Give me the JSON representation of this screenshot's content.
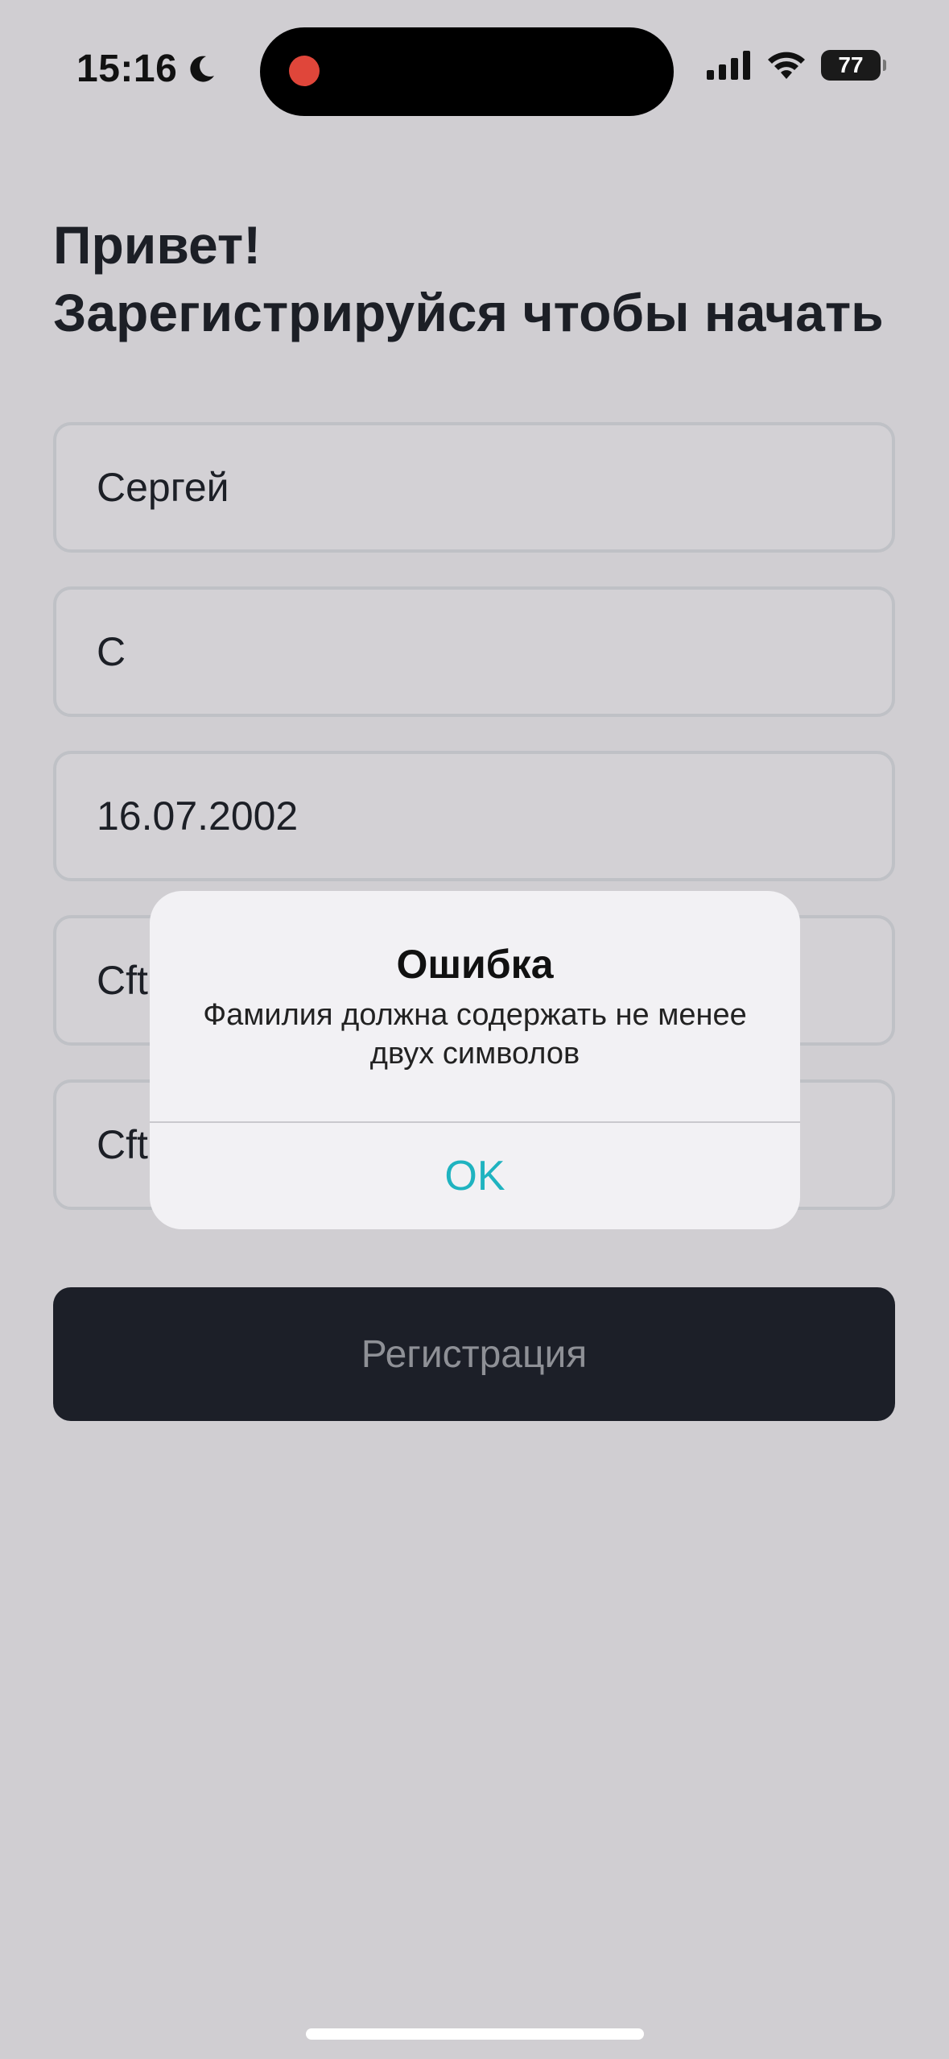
{
  "status_bar": {
    "time": "15:16",
    "battery": "77",
    "icons": [
      "moon-icon",
      "cellular-signal-icon",
      "wifi-icon",
      "battery-icon"
    ]
  },
  "recording_indicator": {
    "color": "#e0463a"
  },
  "heading": {
    "line1": "Привет!",
    "line2": "Зарегистрируйся чтобы начать"
  },
  "form": {
    "first_name": "Сергей",
    "last_name": "С",
    "birth_date": "16.07.2002",
    "field4": "Cft",
    "field5": "Cft"
  },
  "register_button": {
    "label": "Регистрация"
  },
  "alert": {
    "title": "Ошибка",
    "message": "Фамилия должна содержать не менее двух символов",
    "ok_label": "OK",
    "ok_color": "#1fb3c0"
  },
  "colors": {
    "background": "#d0ced2",
    "button": "#1c1f28",
    "field_border": "#bfc1c6"
  }
}
